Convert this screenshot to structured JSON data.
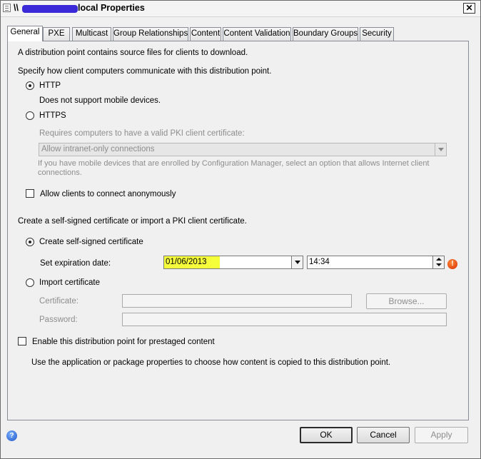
{
  "window": {
    "title_prefix": "\\\\",
    "title": "local Properties",
    "close_glyph": "✕",
    "icons": [
      "properties-window-icon",
      "close-icon",
      "help-icon",
      "error-icon"
    ]
  },
  "tabs": [
    {
      "label": "General",
      "active": true
    },
    {
      "label": "PXE"
    },
    {
      "label": "Multicast"
    },
    {
      "label": "Group Relationships"
    },
    {
      "label": "Content"
    },
    {
      "label": "Content Validation"
    },
    {
      "label": "Boundary Groups"
    },
    {
      "label": "Security"
    }
  ],
  "general": {
    "intro": "A distribution point contains source files for clients to download.",
    "comm_heading": "Specify how client computers communicate with this distribution point.",
    "http_label": "HTTP",
    "http_note": "Does not support mobile devices.",
    "https_label": "HTTPS",
    "https_note": "Requires computers to have a valid PKI client certificate:",
    "intranet_select": "Allow intranet-only connections",
    "mobile_note": "If you have mobile devices that are enrolled by Configuration Manager, select an option that allows Internet client connections.",
    "anonymous_label": "Allow clients to connect anonymously",
    "cert_heading": "Create a self-signed certificate or import a PKI client certificate.",
    "self_signed_label": "Create self-signed certificate",
    "expiration_label": "Set expiration date:",
    "expiration_date": "01/06/2013",
    "expiration_time": "14:34",
    "import_label": "Import certificate",
    "certificate_label": "Certificate:",
    "browse_label": "Browse...",
    "password_label": "Password:",
    "prestaged_label": "Enable this distribution point for prestaged content",
    "prestaged_note": "Use the application or package properties to choose how content is copied to this distribution point."
  },
  "footer": {
    "help_glyph": "?",
    "ok": "OK",
    "cancel": "Cancel",
    "apply": "Apply"
  },
  "error_glyph": "!",
  "colors": {
    "highlight": "#f5ff3a",
    "redaction": "#3a2ad8",
    "error": "#d92a00"
  }
}
